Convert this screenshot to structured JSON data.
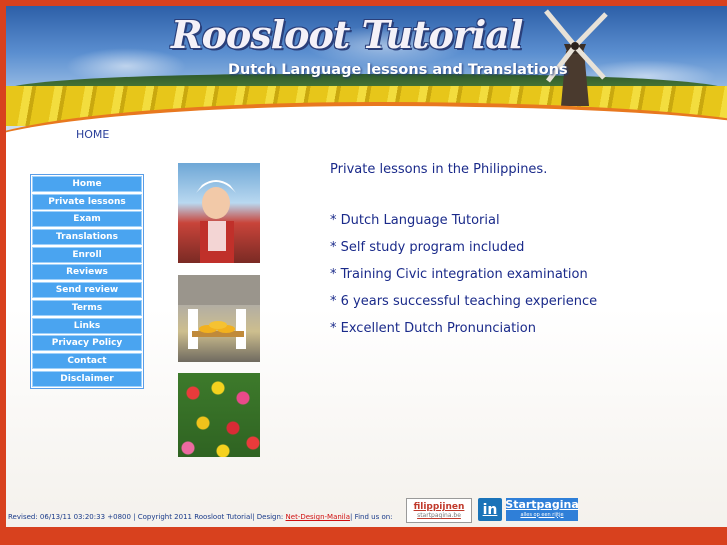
{
  "header": {
    "title": "Roosloot Tutorial",
    "subtitle": "Dutch Language lessons and Translations"
  },
  "top_nav": {
    "home": "HOME"
  },
  "sidebar": {
    "items": [
      "Home",
      "Private lessons",
      "Exam",
      "Translations",
      "Enroll",
      "Reviews",
      "Send review",
      "Terms",
      "Links",
      "Privacy Policy",
      "Contact",
      "Disclaimer"
    ]
  },
  "content": {
    "heading": "Private lessons in the Philippines.",
    "bullets": [
      "* Dutch Language Tutorial",
      "* Self study program included",
      "* Training Civic integration examination",
      "* 6 years successful teaching experience",
      "* Excellent Dutch Pronunciation"
    ]
  },
  "footer": {
    "text_before": "Revised: 06/13/11 03:20:33 +0800 | Copyright 2011 Roosloot Tutorial| Design: ",
    "design_link": "Net-Design-Manila",
    "text_after": "| Find us on:",
    "badges": {
      "filippijnen": "filippijnen",
      "filippijnen_sub": "startpagina.be",
      "linkedin": "in",
      "startpagina": "Startpagina",
      "startpagina_sub": "alles op een rijtje"
    }
  },
  "colors": {
    "border": "#d8411e",
    "nav_button": "#4aa4f0",
    "text": "#1a2a8a"
  }
}
